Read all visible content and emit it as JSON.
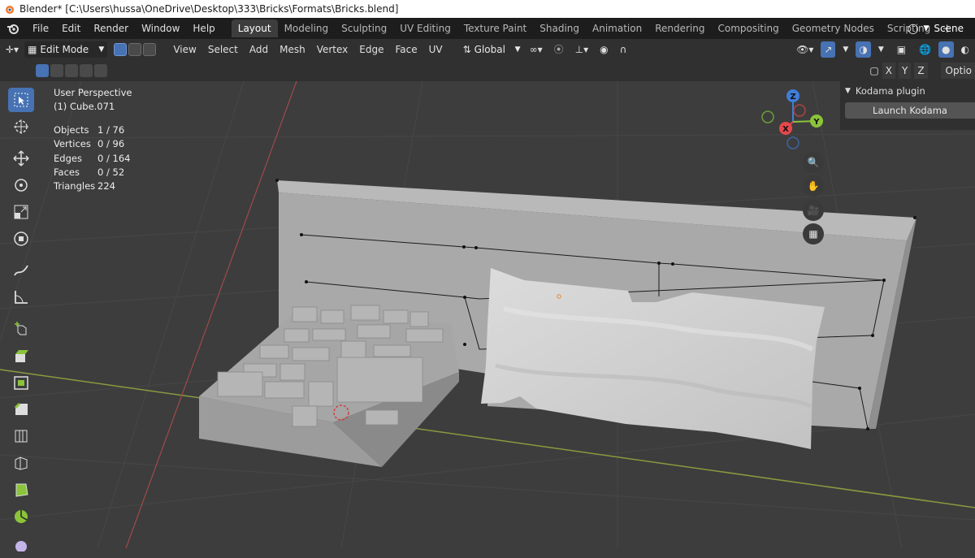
{
  "window": {
    "title": "Blender* [C:\\Users\\hussa\\OneDrive\\Desktop\\333\\Bricks\\Formats\\Bricks.blend]"
  },
  "menu": [
    "File",
    "Edit",
    "Render",
    "Window",
    "Help"
  ],
  "workspaces": [
    "Layout",
    "Modeling",
    "Sculpting",
    "UV Editing",
    "Texture Paint",
    "Shading",
    "Animation",
    "Rendering",
    "Compositing",
    "Geometry Nodes",
    "Scripting"
  ],
  "active_workspace": "Layout",
  "scene": {
    "label": "Scene"
  },
  "header": {
    "mode": "Edit Mode",
    "menus": [
      "View",
      "Select",
      "Add",
      "Mesh",
      "Vertex",
      "Edge",
      "Face",
      "UV"
    ],
    "transform_orientation": "Global",
    "axes": [
      "X",
      "Y",
      "Z"
    ],
    "options_label": "Optio"
  },
  "viewport": {
    "perspective": "User Perspective",
    "object": "(1) Cube.071",
    "stats": [
      {
        "label": "Objects",
        "value": "1 / 76"
      },
      {
        "label": "Vertices",
        "value": "0 / 96"
      },
      {
        "label": "Edges",
        "value": "0 / 164"
      },
      {
        "label": "Faces",
        "value": "0 / 52"
      },
      {
        "label": "Triangles",
        "value": "224"
      }
    ]
  },
  "gizmo": {
    "x": "X",
    "y": "Y",
    "z": "Z",
    "colors": {
      "x": "#e5484d",
      "y": "#8bc43a",
      "z": "#3f7ed8"
    }
  },
  "sidebar_panel": {
    "title": "Kodama plugin",
    "button": "Launch Kodama"
  },
  "toolbar_icons": [
    "select-box-icon",
    "cursor-icon",
    "move-icon",
    "rotate-icon",
    "scale-icon",
    "transform-icon",
    "annotate-icon",
    "measure-icon",
    "add-cube-icon",
    "extrude-icon",
    "inset-icon",
    "bevel-icon",
    "loop-cut-icon",
    "knife-icon",
    "poly-build-icon",
    "spin-icon",
    "smooth-icon"
  ],
  "colors": {
    "accent": "#4772b3",
    "background": "#3d3d3d",
    "header": "#303030",
    "topbar": "#1d1d1d"
  }
}
